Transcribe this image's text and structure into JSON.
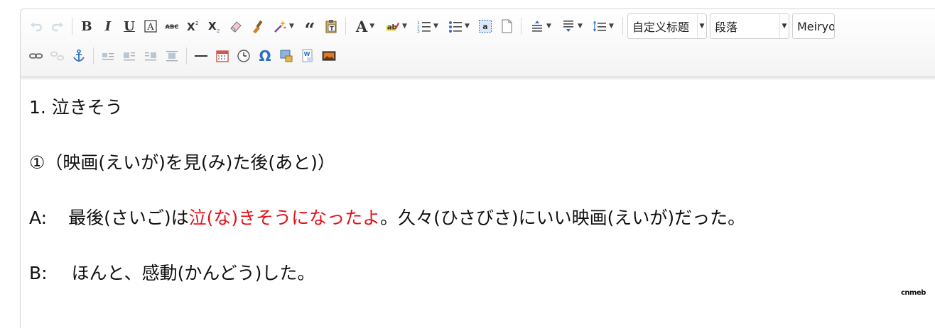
{
  "toolbar": {
    "row1": [
      {
        "name": "undo-icon",
        "icon": "undo",
        "disabled": true
      },
      {
        "name": "redo-icon",
        "icon": "redo",
        "disabled": true
      },
      {
        "sep": true
      },
      {
        "name": "bold-button",
        "icon": "B"
      },
      {
        "name": "italic-button",
        "icon": "I"
      },
      {
        "name": "underline-button",
        "icon": "U"
      },
      {
        "name": "font-border-button",
        "icon": "A-box"
      },
      {
        "name": "strikethrough-button",
        "icon": "ABC"
      },
      {
        "name": "superscript-button",
        "icon": "X2-super"
      },
      {
        "name": "subscript-button",
        "icon": "X2-sub"
      },
      {
        "name": "eraser-icon",
        "icon": "eraser"
      },
      {
        "name": "format-painter-icon",
        "icon": "brush"
      },
      {
        "name": "auto-format-button",
        "icon": "magic-wand",
        "dropdown": true
      },
      {
        "name": "blockquote-icon",
        "icon": "quote"
      },
      {
        "name": "paste-plain-icon",
        "icon": "paste-text"
      },
      {
        "sep": true
      },
      {
        "name": "font-color-button",
        "icon": "A-color",
        "dropdown": true
      },
      {
        "name": "highlight-color-button",
        "icon": "ab-highlight",
        "dropdown": true
      },
      {
        "name": "ordered-list-button",
        "icon": "ol",
        "dropdown": true
      },
      {
        "name": "unordered-list-button",
        "icon": "ul",
        "dropdown": true
      },
      {
        "name": "select-all-icon",
        "icon": "select-all"
      },
      {
        "name": "clear-doc-icon",
        "icon": "blank-page"
      },
      {
        "sep": true
      },
      {
        "name": "row-spacing-top-button",
        "icon": "spacing-top",
        "dropdown": true
      },
      {
        "name": "row-spacing-bottom-button",
        "icon": "spacing-bottom",
        "dropdown": true
      },
      {
        "name": "line-height-button",
        "icon": "line-height",
        "dropdown": true
      },
      {
        "sep": true
      }
    ],
    "combos": [
      {
        "name": "custom-style-select",
        "value": "自定义标题",
        "width": 112
      },
      {
        "name": "paragraph-select",
        "value": "段落",
        "width": 112
      },
      {
        "name": "font-family-select",
        "value": "Meiryo",
        "width": 60
      }
    ],
    "row2": [
      {
        "name": "link-icon",
        "icon": "link"
      },
      {
        "name": "unlink-icon",
        "icon": "unlink",
        "disabled": true
      },
      {
        "name": "anchor-icon",
        "icon": "anchor"
      },
      {
        "sep": true
      },
      {
        "name": "image-none-icon",
        "icon": "img-none"
      },
      {
        "name": "image-left-icon",
        "icon": "img-left"
      },
      {
        "name": "image-right-icon",
        "icon": "img-right"
      },
      {
        "name": "image-center-icon",
        "icon": "img-center"
      },
      {
        "sep": true
      },
      {
        "name": "horizontal-rule-icon",
        "icon": "hr"
      },
      {
        "name": "date-icon",
        "icon": "calendar"
      },
      {
        "name": "time-icon",
        "icon": "clock"
      },
      {
        "name": "special-chars-icon",
        "icon": "omega"
      },
      {
        "name": "insert-image-icon",
        "icon": "image-insert"
      },
      {
        "name": "word-image-icon",
        "icon": "word-image"
      },
      {
        "name": "background-image-icon",
        "icon": "picture"
      }
    ]
  },
  "content": {
    "line1": "1. 泣きそう",
    "line2": "①（映画(えいが)を見(み)た後(あと)）",
    "line3_speaker": "A:",
    "line3_pre": "最後(さいご)は",
    "line3_red": "泣(な)きそうになったよ",
    "line3_post": "。久々(ひさびさ)にいい映画(えいが)だった。",
    "line4_speaker": "B:",
    "line4_text": "ほんと、感動(かんどう)した。"
  },
  "logo_text": "cnmeb",
  "colors": {
    "highlight_red": "#e3101a",
    "icon_blue": "#2f6fc0",
    "text": "#111111"
  }
}
